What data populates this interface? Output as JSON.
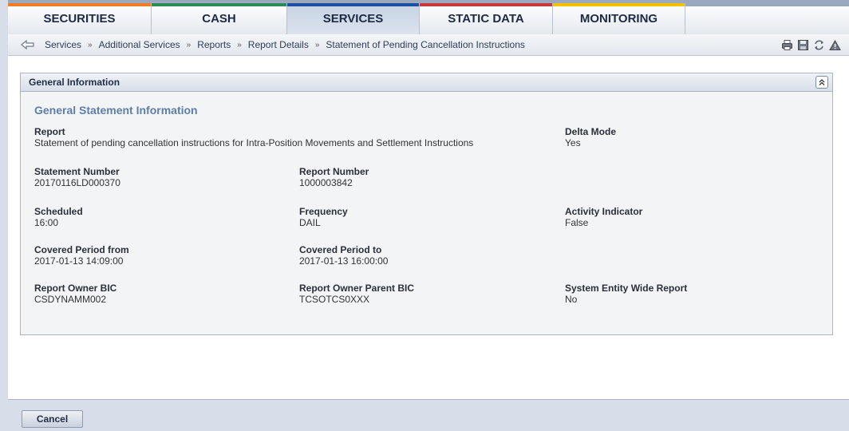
{
  "nav": {
    "tabs": [
      {
        "label": "SECURITIES",
        "stripe_color": "#f07c2a",
        "active": false
      },
      {
        "label": "CASH",
        "stripe_color": "#2e8b57",
        "active": false
      },
      {
        "label": "SERVICES",
        "stripe_color": "#1e4fa0",
        "active": true
      },
      {
        "label": "STATIC DATA",
        "stripe_color": "#c8383c",
        "active": false
      },
      {
        "label": "MONITORING",
        "stripe_color": "#f2c200",
        "active": false
      }
    ]
  },
  "breadcrumb": {
    "items": [
      "Services",
      "Additional Services",
      "Reports",
      "Report Details",
      "Statement of Pending Cancellation Instructions"
    ],
    "separator": "»"
  },
  "toolbar": {
    "icons": [
      "print-icon",
      "save-icon",
      "refresh-icon",
      "alert-icon"
    ]
  },
  "panel": {
    "title": "General Information",
    "section_title": "General Statement Information",
    "fields": {
      "report": {
        "label": "Report",
        "value": "Statement of pending cancellation instructions for Intra-Position Movements and Settlement Instructions"
      },
      "delta_mode": {
        "label": "Delta Mode",
        "value": "Yes"
      },
      "statement_number": {
        "label": "Statement Number",
        "value": "20170116LD000370"
      },
      "report_number": {
        "label": "Report Number",
        "value": "1000003842"
      },
      "scheduled": {
        "label": "Scheduled",
        "value": "16:00"
      },
      "frequency": {
        "label": "Frequency",
        "value": "DAIL"
      },
      "activity_indicator": {
        "label": "Activity Indicator",
        "value": "False"
      },
      "covered_from": {
        "label": "Covered Period from",
        "value": "2017-01-13 14:09:00"
      },
      "covered_to": {
        "label": "Covered Period to",
        "value": "2017-01-13 16:00:00"
      },
      "owner_bic": {
        "label": "Report Owner BIC",
        "value": "CSDYNAMM002"
      },
      "owner_parent_bic": {
        "label": "Report Owner Parent BIC",
        "value": "TCSOTCS0XXX"
      },
      "entity_wide": {
        "label": "System Entity Wide Report",
        "value": "No"
      }
    }
  },
  "footer": {
    "cancel_label": "Cancel"
  }
}
